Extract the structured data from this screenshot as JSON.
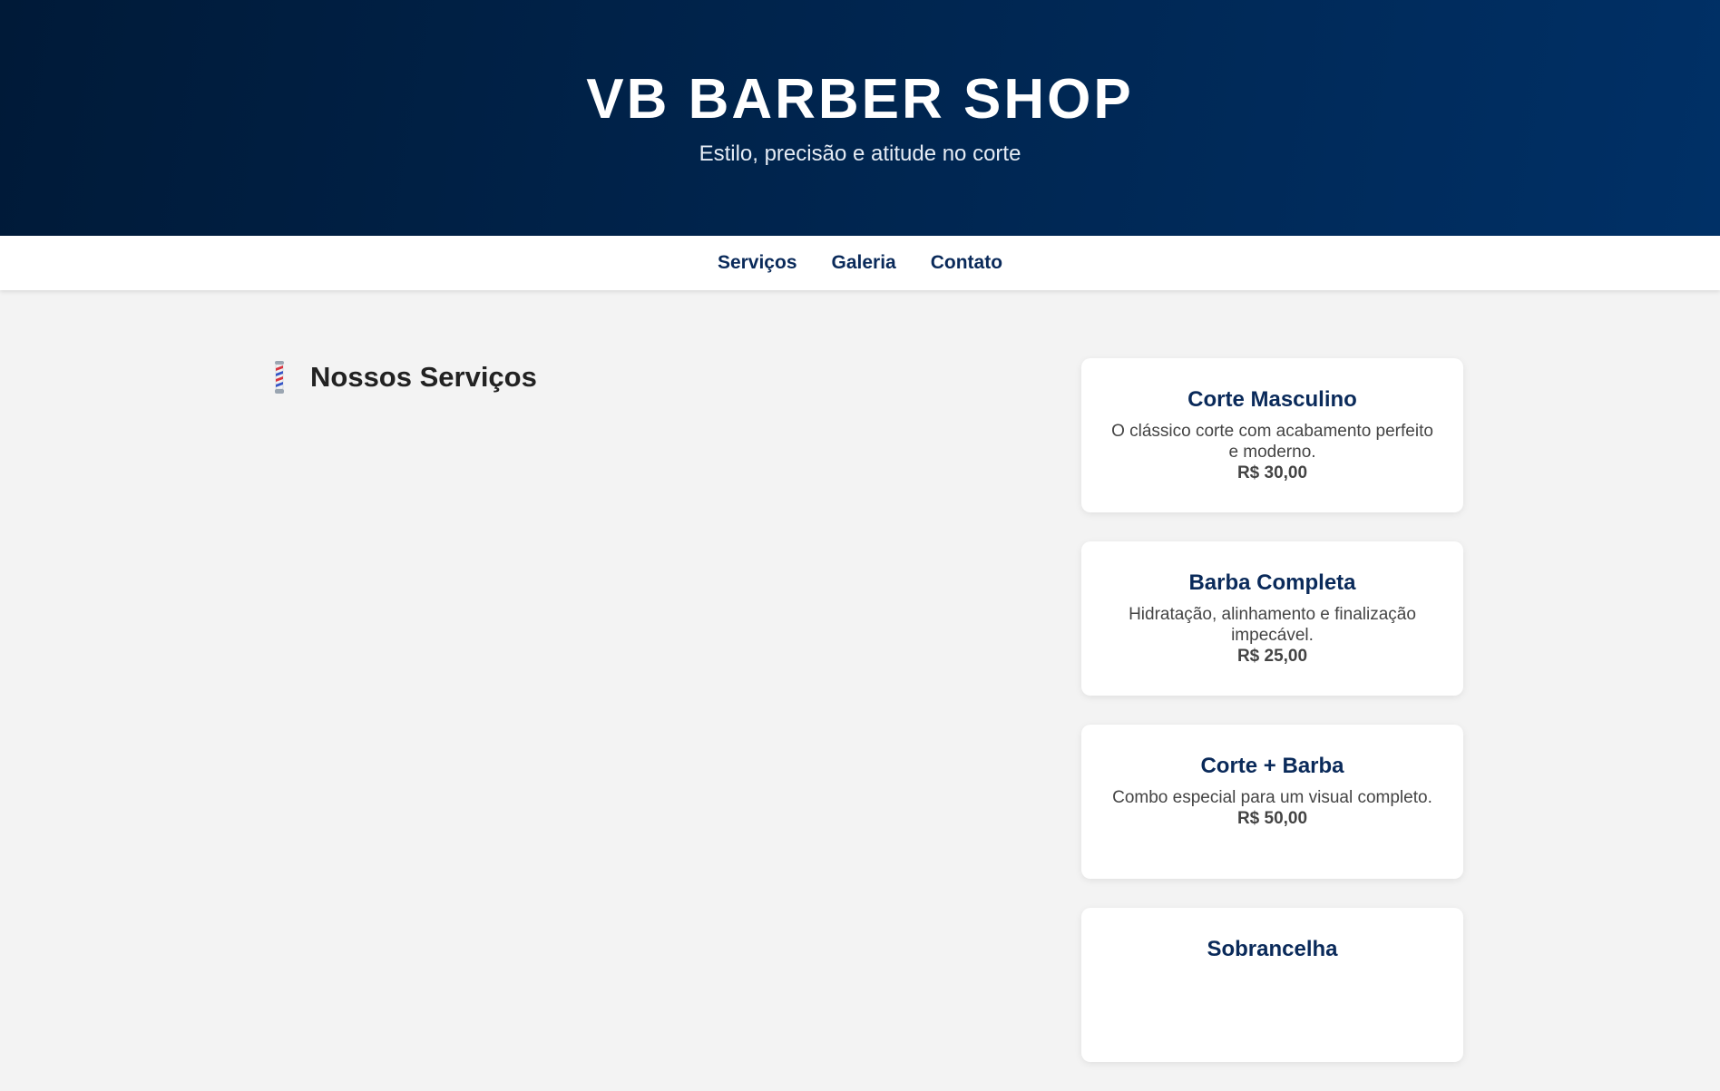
{
  "header": {
    "title": "VB BARBER SHOP",
    "subtitle": "Estilo, precisão e atitude no corte"
  },
  "nav": {
    "items": [
      "Serviços",
      "Galeria",
      "Contato"
    ]
  },
  "services_section": {
    "icon": "barber-pole-icon",
    "title": "Nossos Serviços"
  },
  "services": [
    {
      "name": "Corte Masculino",
      "description": "O clássico corte com acabamento perfeito e moderno.",
      "price": "R$ 30,00"
    },
    {
      "name": "Barba Completa",
      "description": "Hidratação, alinhamento e finalização impecável.",
      "price": "R$ 25,00"
    },
    {
      "name": "Corte + Barba",
      "description": "Combo especial para um visual completo.",
      "price": "R$ 50,00"
    },
    {
      "name": "Sobrancelha",
      "description": "",
      "price": ""
    }
  ],
  "colors": {
    "header_dark": "#001a38",
    "header_light": "#003066",
    "accent_text": "#0a2a5a",
    "page_background": "#f3f3f3"
  }
}
